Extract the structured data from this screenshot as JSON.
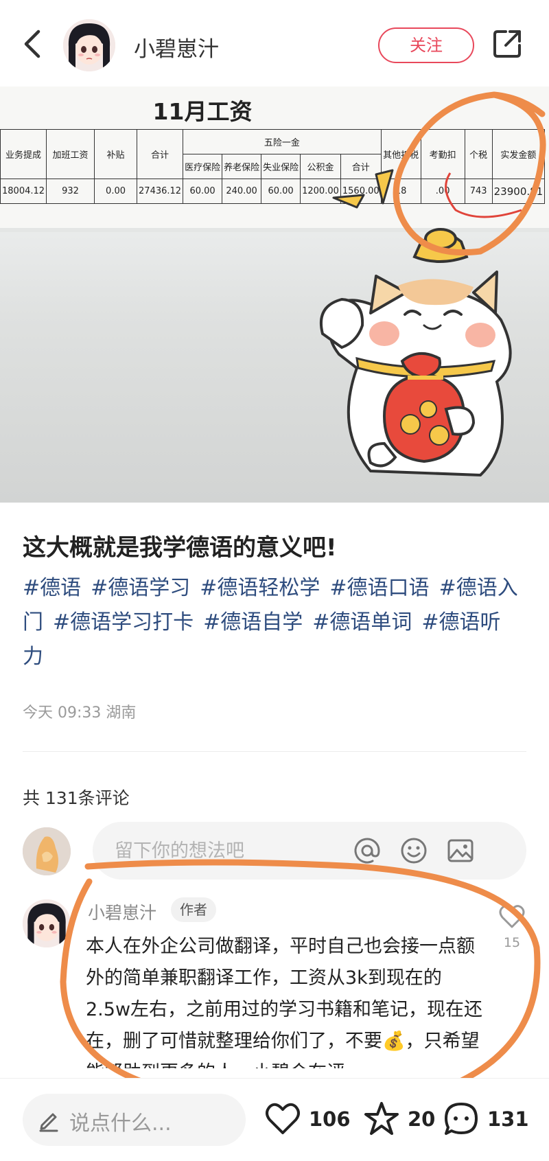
{
  "header": {
    "author": "小碧崽汁",
    "follow_label": "关注"
  },
  "photo": {
    "sheet_title": "11月工资",
    "table": {
      "headers": [
        "业务提成",
        "加班工资",
        "补贴",
        "合计",
        "五险一金",
        "其他扣税",
        "考勤扣",
        "个税",
        "实发金额"
      ],
      "sub_headers": [
        "医疗保险",
        "养老保险",
        "失业保险",
        "公积金",
        "合计"
      ],
      "values": [
        "18004.12",
        "932",
        "0.00",
        "27436.12",
        "60.00",
        "240.00",
        "60.00",
        "1200.00",
        "1560.00",
        "18",
        ".00",
        "743",
        "23900.81"
      ]
    }
  },
  "post": {
    "title": "这大概就是我学德语的意义吧!",
    "tags": [
      "#德语",
      "#德语学习",
      "#德语轻松学",
      "#德语口语",
      "#德语入门",
      "#德语学习打卡",
      "#德语自学",
      "#德语单词",
      "#德语听力"
    ],
    "meta": "今天 09:33 湖南"
  },
  "comments": {
    "count_label": "共 131条评论",
    "input_placeholder": "留下你的想法吧",
    "first": {
      "name": "小碧崽汁",
      "badge": "作者",
      "text": "本人在外企公司做翻译，平时自己也会接一点额外的简单兼职翻译工作，工资从3k到现在的2.5w左右，之前用过的学习书籍和笔记，现在还在，删了可惜就整理给你们了，不要💰，只希望能帮助到更多的人。小碧会在评",
      "likes": "15"
    }
  },
  "bottom": {
    "say_placeholder": "说点什么...",
    "likes": "106",
    "favorites": "20",
    "comments": "131"
  },
  "colors": {
    "accent": "#e8485b",
    "tag": "#2e4c7e",
    "annotation": "#ee8c4a"
  }
}
